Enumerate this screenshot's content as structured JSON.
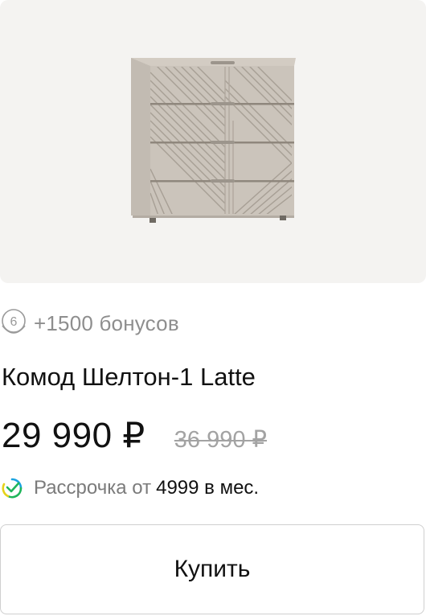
{
  "product": {
    "image_alt": "Комод Шелтон-1 Latte",
    "bonus_badge": "6",
    "bonus_text": "+1500 бонусов",
    "title": "Комод Шелтон-1 Latte",
    "price": "29 990 ₽",
    "old_price": "36 990 ₽",
    "installment_label": "Рассрочка от",
    "installment_amount": "4999 в мес.",
    "buy_label": "Купить"
  },
  "colors": {
    "image_background": "#f4f3f1",
    "product_color": "#c9c2b9",
    "muted_text": "#8e8e8e",
    "old_price": "#a3a3a3",
    "check_green": "#1fb55a",
    "check_yellow": "#e5d21a",
    "check_blue": "#1aa3e0"
  }
}
